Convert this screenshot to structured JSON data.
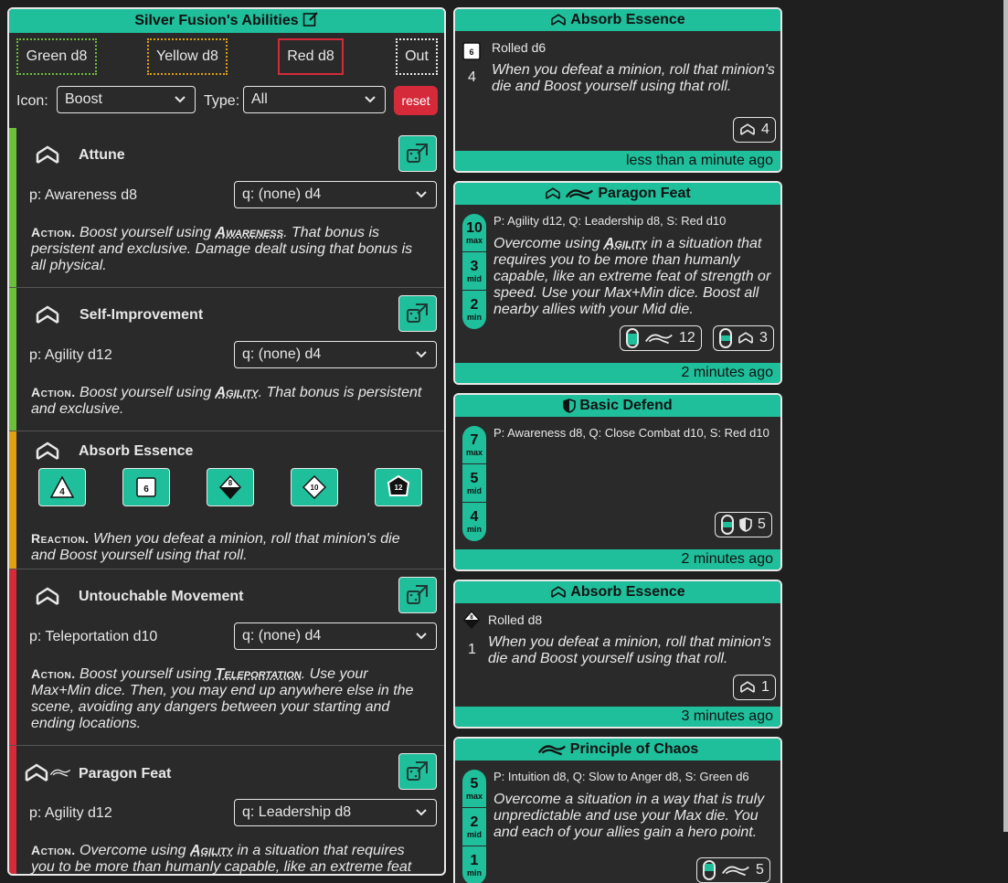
{
  "left": {
    "title": "Silver Fusion's Abilities",
    "status": {
      "green": "Green d8",
      "yellow": "Yellow d8",
      "red": "Red d8",
      "out": "Out"
    },
    "filter": {
      "icon_label": "Icon:",
      "icon_value": "Boost",
      "type_label": "Type:",
      "type_value": "All",
      "reset": "reset"
    },
    "abilities": [
      {
        "title": "Attune",
        "p": "p: Awareness d8",
        "q": "q: (none) d4",
        "kind": "Action.",
        "pre": " Boost yourself using ",
        "skill": "Awareness",
        "post": ". That bonus is persistent and exclusive. Damage dealt using that bonus is all physical."
      },
      {
        "title": "Self-Improvement",
        "p": "p: Agility d12",
        "q": "q: (none) d4",
        "kind": "Action.",
        "pre": " Boost yourself using ",
        "skill": "Agility",
        "post": ". That bonus is persistent and exclusive."
      },
      {
        "title": "Absorb Essence",
        "dice": [
          "4",
          "6",
          "8",
          "10",
          "12"
        ],
        "kind": "Reaction.",
        "text": " When you defeat a minion, roll that minion's die and Boost yourself using that roll."
      },
      {
        "title": "Untouchable Movement",
        "p": "p: Teleportation d10",
        "q": "q: (none) d4",
        "kind": "Action.",
        "pre": " Boost yourself using ",
        "skill": "Teleportation",
        "post": ". Use your Max+Min dice. Then, you may end up anywhere else in the scene, avoiding any dangers between your starting and ending locations."
      },
      {
        "title": "Paragon Feat",
        "p": "p: Agility d12",
        "q": "q: Leadership d8",
        "kind": "Action.",
        "pre": " Overcome using ",
        "skill": "Agility",
        "post": " in a situation that requires you to be more than humanly capable, like an extreme feat of"
      }
    ]
  },
  "cards": [
    {
      "title": "Absorb Essence",
      "rolled_label": "Rolled d6",
      "rolled_die": "6",
      "rolled_value": "4",
      "desc": "When you defeat a minion, roll that minion's die and Boost yourself using that roll.",
      "result": "4",
      "footer": "less than a minute ago"
    },
    {
      "title": "Paragon Feat",
      "dice": "P: Agility d12, Q: Leadership d8, S: Red d10",
      "stack": [
        "10",
        "3",
        "2"
      ],
      "desc_pre": "Overcome using ",
      "skill": "Agility",
      "desc_post": " in a situation that requires you to be more than humanly capable, like an extreme feat of strength or speed. Use your Max+Min dice. Boost all nearby allies with your Mid die.",
      "results": [
        "12",
        "3"
      ],
      "footer": "2 minutes ago"
    },
    {
      "title": "Basic Defend",
      "dice": "P: Awareness d8, Q: Close Combat d10, S: Red d10",
      "stack": [
        "7",
        "5",
        "4"
      ],
      "result": "5",
      "footer": "2 minutes ago"
    },
    {
      "title": "Absorb Essence",
      "rolled_label": "Rolled d8",
      "rolled_die": "8",
      "rolled_value": "1",
      "desc": "When you defeat a minion, roll that minion's die and Boost yourself using that roll.",
      "result": "1",
      "footer": "3 minutes ago"
    },
    {
      "title": "Principle of Chaos",
      "dice": "P: Intuition d8, Q: Slow to Anger d8, S: Green d6",
      "stack": [
        "5",
        "2",
        "1"
      ],
      "desc": "Overcome a situation in a way that is truly unpredictable and use your Max die. You and each of your allies gain a hero point.",
      "result": "5"
    }
  ],
  "stack_labels": [
    "max",
    "mid",
    "min"
  ],
  "colors": {
    "accent": "#1fbf9b",
    "green": "#6cbf3b",
    "yellow": "#e0a010",
    "red": "#d42a3a"
  }
}
